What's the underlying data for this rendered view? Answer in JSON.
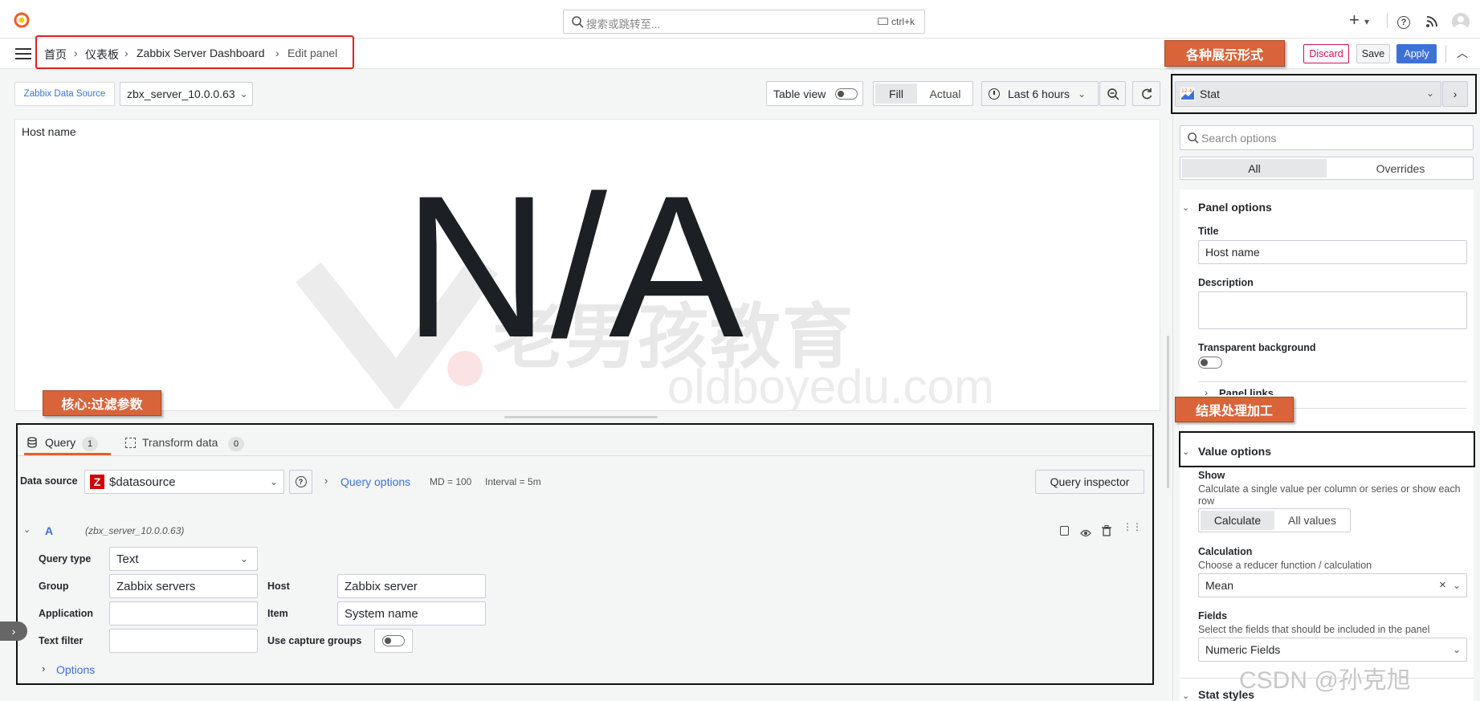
{
  "topbar": {
    "search_placeholder": "搜索或跳转至...",
    "search_shortcut": "ctrl+k",
    "plus_label": "+"
  },
  "breadcrumb": {
    "home": "首页",
    "dashboards": "仪表板",
    "dashboard": "Zabbix Server Dashboard",
    "current": "Edit panel"
  },
  "header_actions": {
    "discard": "Discard",
    "save": "Save",
    "apply": "Apply"
  },
  "panel_toolbar": {
    "datasource_chip": "Zabbix Data Source",
    "datasource_value": "zbx_server_10.0.0.63",
    "table_view": "Table view",
    "fill": "Fill",
    "actual": "Actual",
    "time_range": "Last 6 hours"
  },
  "preview": {
    "panel_title": "Host name",
    "value": "N/A",
    "watermark_cn": "老男孩教育",
    "watermark_en": "oldboyedu.com"
  },
  "query_tabs": {
    "query_label": "Query",
    "query_count": "1",
    "transform_label": "Transform data",
    "transform_count": "0"
  },
  "query_row": {
    "datasource_label": "Data source",
    "datasource_value": "$datasource",
    "query_options": "Query options",
    "md": "MD = 100",
    "interval": "Interval = 5m",
    "inspector": "Query inspector"
  },
  "query_a": {
    "ref": "A",
    "source": "(zbx_server_10.0.0.63)",
    "query_type_label": "Query type",
    "query_type_value": "Text",
    "group_label": "Group",
    "group_value": "Zabbix servers",
    "host_label": "Host",
    "host_value": "Zabbix server",
    "application_label": "Application",
    "application_value": "",
    "item_label": "Item",
    "item_value": "System name",
    "text_filter_label": "Text filter",
    "text_filter_value": "",
    "capture_label": "Use capture groups",
    "options": "Options"
  },
  "options_pane": {
    "viz": "Stat",
    "search_placeholder": "Search options",
    "tab_all": "All",
    "tab_overrides": "Overrides",
    "panel_options": "Panel options",
    "title_label": "Title",
    "title_value": "Host name",
    "description_label": "Description",
    "transparent_label": "Transparent background",
    "panel_links": "Panel links",
    "value_options": "Value options",
    "show_label": "Show",
    "show_desc": "Calculate a single value per column or series or show each row",
    "calculate": "Calculate",
    "all_values": "All values",
    "calculation_label": "Calculation",
    "calculation_desc": "Choose a reducer function / calculation",
    "calculation_value": "Mean",
    "fields_label": "Fields",
    "fields_desc": "Select the fields that should be included in the panel",
    "fields_value": "Numeric Fields",
    "stat_styles": "Stat styles"
  },
  "annotations": {
    "display_forms": "各种展示形式",
    "core_filter": "核心:过滤参数",
    "result_processing": "结果处理加工"
  },
  "watermark_csdn": "CSDN @孙克旭",
  "colors": {
    "accent": "#3d71d9",
    "annotation": "#d9643a",
    "discard": "#d10e5c",
    "highlight_red": "#e02020"
  }
}
